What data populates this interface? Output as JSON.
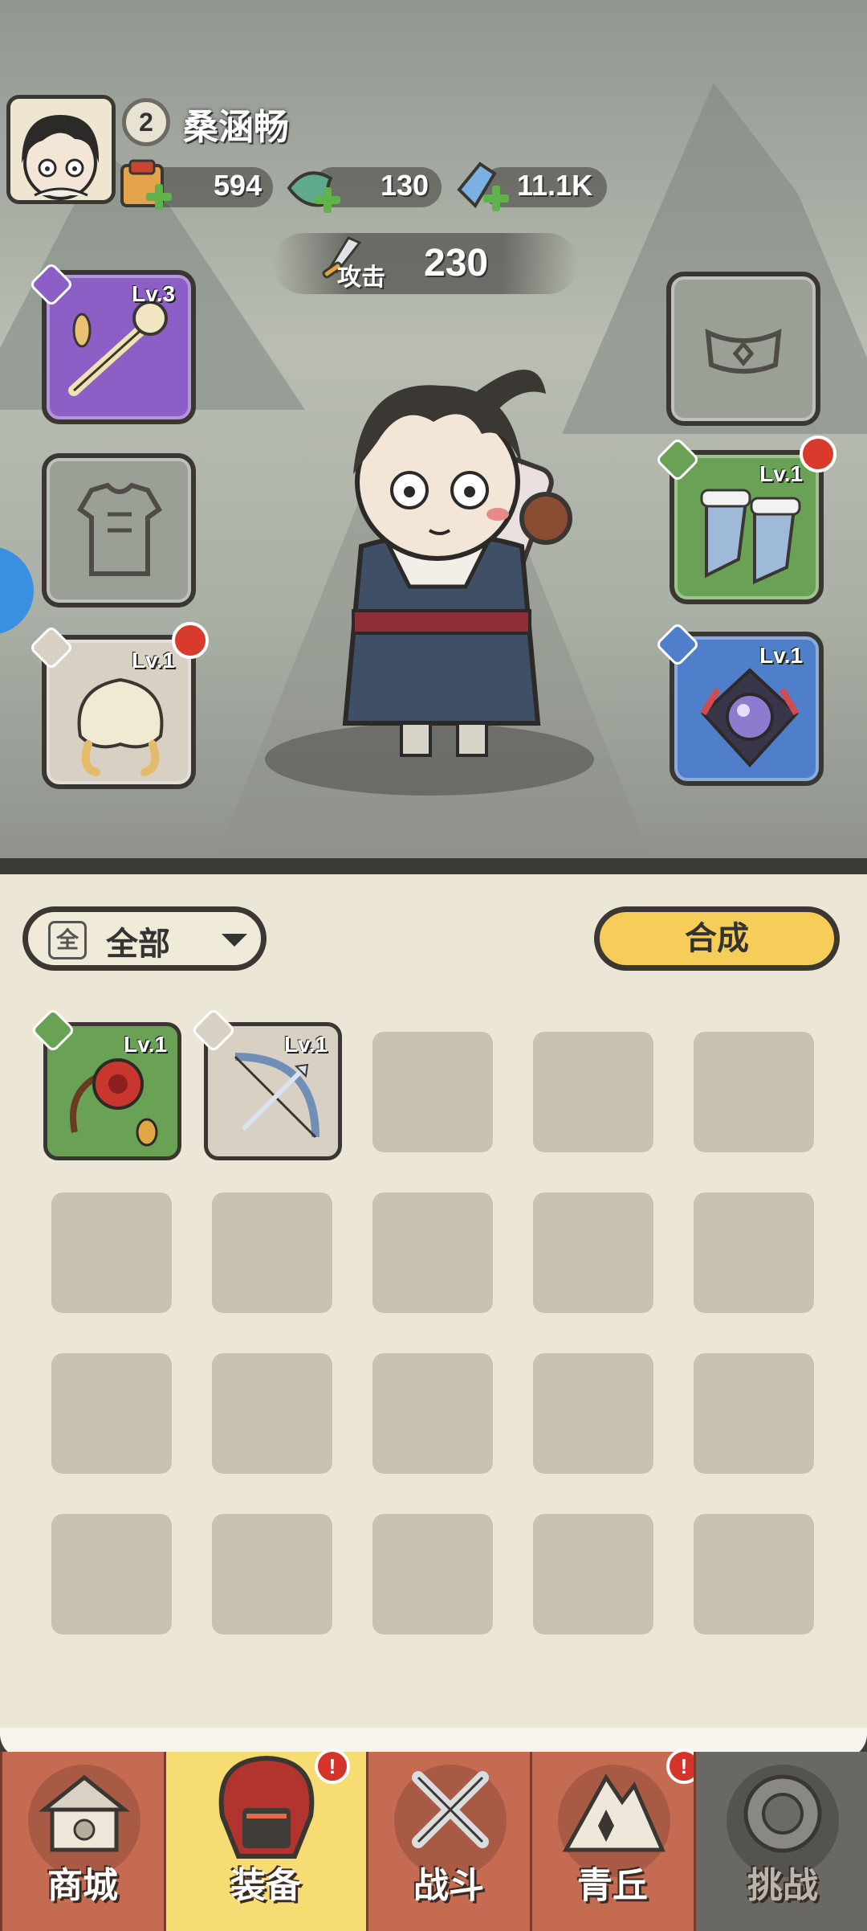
{
  "player": {
    "name": "桑涵畅",
    "level": "2"
  },
  "resources": [
    {
      "icon": "scroll-bundle-icon",
      "value": "594"
    },
    {
      "icon": "jade-fish-icon",
      "value": "130"
    },
    {
      "icon": "crystal-icon",
      "value": "11.1K"
    }
  ],
  "stats": {
    "attack_label": "攻击",
    "attack_value": "230"
  },
  "equipment": {
    "weapon": {
      "level": "Lv.3",
      "rarity": "purple"
    },
    "belt": {
      "level": ""
    },
    "armor": {
      "level": ""
    },
    "boots": {
      "level": "Lv.1",
      "rarity": "green",
      "upgrade": true
    },
    "helmet": {
      "level": "Lv.1",
      "rarity": "grey",
      "upgrade": true
    },
    "amulet": {
      "level": "Lv.1",
      "rarity": "blue"
    }
  },
  "inventory": {
    "filter_icon": "全",
    "filter_label": "全部",
    "synthesize_label": "合成",
    "items": [
      {
        "icon": "flower-whip-icon",
        "level": "Lv.1",
        "rarity": "green"
      },
      {
        "icon": "bow-icon",
        "level": "Lv.1",
        "rarity": "grey"
      }
    ]
  },
  "nav": {
    "tabs": [
      {
        "label": "商城",
        "icon": "shop-icon"
      },
      {
        "label": "装备",
        "icon": "helmet-icon",
        "active": true,
        "alert": "!"
      },
      {
        "label": "战斗",
        "icon": "crossed-swords-icon"
      },
      {
        "label": "青丘",
        "icon": "mountain-icon",
        "alert": "!"
      },
      {
        "label": "挑战",
        "icon": "challenge-icon"
      }
    ]
  },
  "colors": {
    "accent_yellow": "#f6cd58",
    "tab_red": "#c46b52",
    "alert_red": "#d6342a"
  }
}
